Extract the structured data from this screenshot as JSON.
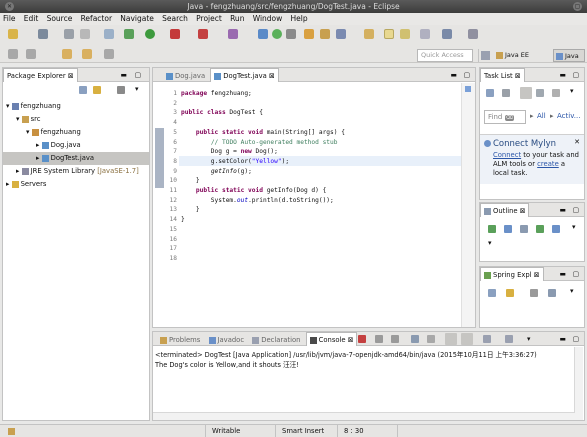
{
  "window": {
    "title": "Java - fengzhuang/src/fengzhuang/DogTest.java - Eclipse"
  },
  "menu": [
    "File",
    "Edit",
    "Source",
    "Refactor",
    "Navigate",
    "Search",
    "Project",
    "Run",
    "Window",
    "Help"
  ],
  "quick_access": {
    "placeholder": "Quick Access"
  },
  "perspectives": {
    "javaee": "Java EE",
    "java": "Java"
  },
  "package_explorer": {
    "tab": "Package Explorer",
    "tree": {
      "project": "fengzhuang",
      "src": "src",
      "package": "fengzhuang",
      "file1": "Dog.java",
      "file2": "DogTest.java",
      "jre": "JRE System Library",
      "jre_ver": "[JavaSE-1.7]",
      "servers": "Servers"
    }
  },
  "editor": {
    "tabs": [
      "Dog.java",
      "DogTest.java"
    ],
    "line_numbers": [
      "1",
      "2",
      "3",
      "4",
      "5",
      "6",
      "7",
      "8",
      "9",
      "10",
      "11",
      "12",
      "13",
      "14",
      "15",
      "16",
      "17",
      "18"
    ]
  },
  "task_list": {
    "tab": "Task List",
    "find_placeholder": "Find",
    "all": "All",
    "activate": "Activ..."
  },
  "mylyn": {
    "title": "Connect Mylyn",
    "connect_link": "Connect",
    "text1": "to your task and",
    "text2": "ALM tools or",
    "create_link": "create",
    "text3": "a",
    "text4": "local task."
  },
  "outline": {
    "tab": "Outline"
  },
  "spring": {
    "tab": "Spring Expl"
  },
  "bottom_tabs": [
    "Problems",
    "Javadoc",
    "Declaration",
    "Console"
  ],
  "console": {
    "header": "<terminated> DogTest [Java Application] /usr/lib/jvm/java-7-openjdk-amd64/bin/java (2015年10月11日 上午3:36:27)",
    "output": "The Dog's color is Yellow,and it shouts 汪汪!"
  },
  "status_bar": {
    "writable": "Writable",
    "insert": "Smart Insert",
    "position": "8 : 30"
  }
}
